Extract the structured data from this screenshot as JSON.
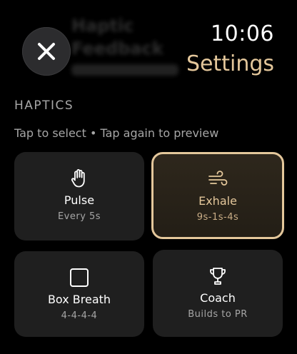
{
  "status": {
    "time": "10:06"
  },
  "header": {
    "title": "Settings",
    "ghost_line1": "Haptic",
    "ghost_line2": "Feedback"
  },
  "section": {
    "title": "HAPTICS",
    "hint": "Tap to select • Tap again to preview"
  },
  "tiles": [
    {
      "name": "Pulse",
      "sub": "Every 5s",
      "icon": "hand-icon",
      "selected": false
    },
    {
      "name": "Exhale",
      "sub": "9s-1s-4s",
      "icon": "wind-icon",
      "selected": true
    },
    {
      "name": "Box Breath",
      "sub": "4-4-4-4",
      "icon": "square-icon",
      "selected": false
    },
    {
      "name": "Coach",
      "sub": "Builds to PR",
      "icon": "trophy-icon",
      "selected": false
    }
  ],
  "colors": {
    "accent": "#e4c79b",
    "tile_bg": "#1f1f1f",
    "muted_text": "#a6a6a6"
  }
}
